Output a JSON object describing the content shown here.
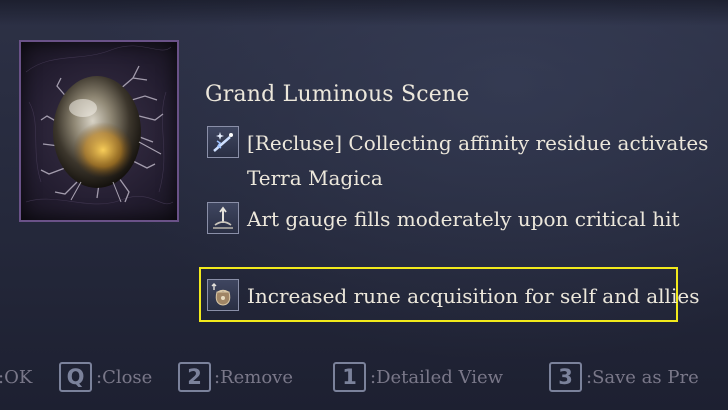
{
  "item": {
    "name": "Grand Luminous Scene",
    "icon": "luminous-scene-relic-icon"
  },
  "effects": [
    {
      "icon": "magic-spark-icon",
      "line1": "[Recluse] Collecting affinity residue activates",
      "line2": "Terra Magica"
    },
    {
      "icon": "art-gauge-icon",
      "line1": "Art gauge fills moderately upon critical hit"
    },
    {
      "icon": "rune-pouch-icon",
      "line1": "Increased rune acquisition for self and allies",
      "highlighted": true
    }
  ],
  "colors": {
    "highlight": "#f2ea1c",
    "frame_border": "#6a5288",
    "key_border": "#8c93ae"
  },
  "footer": {
    "ok_label": ":OK",
    "close_key": "Q",
    "close_label": ":Close",
    "remove_key": "2",
    "remove_label": ":Remove",
    "detail_key": "1",
    "detail_label": ":Detailed View",
    "save_key": "3",
    "save_label": ":Save as Pre"
  }
}
